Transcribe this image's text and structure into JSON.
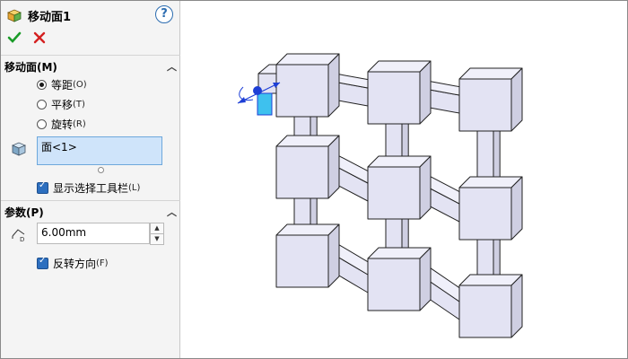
{
  "panel": {
    "title": "移动面1",
    "help_label": "?",
    "section_move_face": {
      "title": "移动面(M)",
      "options": [
        {
          "label": "等距",
          "shortcut": "(O)",
          "selected": true
        },
        {
          "label": "平移",
          "shortcut": "(T)",
          "selected": false
        },
        {
          "label": "旋转",
          "shortcut": "(R)",
          "selected": false
        }
      ],
      "face_selection": "面<1>",
      "show_toolbar_label": "显示选择工具栏",
      "show_toolbar_shortcut": "(L)",
      "show_toolbar_checked": true
    },
    "section_params": {
      "title": "参数(P)",
      "distance_value": "6.00mm",
      "distance_icon_letter": "D",
      "reverse_label": "反转方向",
      "reverse_shortcut": "(F)",
      "reverse_checked": true
    }
  },
  "colors": {
    "ok": "#1a9b28",
    "cancel": "#d42020",
    "selection_fill": "#cfe4fa",
    "selected_face": "#3ec1ee",
    "cube_face": "#e3e3f3",
    "cube_edge": "#222222",
    "handle": "#1d3fd6"
  },
  "icons": [
    "move-face-feature-icon",
    "help-icon",
    "ok-icon",
    "cancel-icon",
    "collapse-icon",
    "face-selection-icon",
    "distance-icon"
  ]
}
